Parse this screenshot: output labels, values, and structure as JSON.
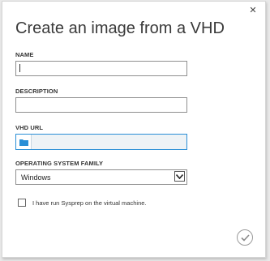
{
  "dialog": {
    "title": "Create an image from a VHD",
    "close_icon": "close-icon"
  },
  "fields": {
    "name": {
      "label": "NAME",
      "value": ""
    },
    "description": {
      "label": "DESCRIPTION",
      "value": ""
    },
    "vhd_url": {
      "label": "VHD URL",
      "value": "",
      "browse_icon": "folder-icon"
    },
    "os_family": {
      "label": "OPERATING SYSTEM FAMILY",
      "selected": "Windows",
      "dropdown_icon": "chevron-down-icon"
    }
  },
  "sysprep": {
    "label": "I have run Sysprep on the virtual machine.",
    "checked": false
  },
  "actions": {
    "confirm_icon": "checkmark-icon"
  },
  "colors": {
    "focus_border": "#2a8fd6",
    "folder_icon": "#2a8fd6",
    "disabled_bg": "#eef3f6"
  }
}
